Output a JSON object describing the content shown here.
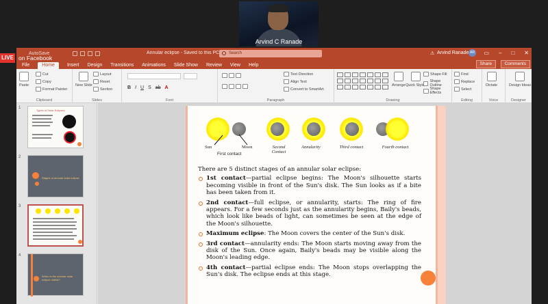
{
  "meeting": {
    "participant_name": "Arvind C Ranade",
    "live_label": "LIVE",
    "stream_label": "on Facebook"
  },
  "app": {
    "autosave": "AutoSave",
    "doc_title": "Annular eclipse - Saved to this PC",
    "search_placeholder": "Search",
    "user_name": "Arvind Ranade",
    "user_initials": "AR",
    "share": "Share",
    "comments": "Comments"
  },
  "menu": [
    "File",
    "Home",
    "Insert",
    "Design",
    "Transitions",
    "Animations",
    "Slide Show",
    "Review",
    "View",
    "Help"
  ],
  "ribbon": {
    "groups": [
      "Clipboard",
      "Slides",
      "Font",
      "Paragraph",
      "Drawing",
      "Editing",
      "Voice",
      "Designer"
    ],
    "clipboard": {
      "paste": "Paste",
      "cut": "Cut",
      "copy": "Copy",
      "format_painter": "Format Painter"
    },
    "slides": {
      "new_slide": "New Slide",
      "layout": "Layout",
      "reset": "Reset",
      "section": "Section"
    },
    "paragraph": {
      "text_direction": "Text Direction",
      "align_text": "Align Text",
      "smartart": "Convert to SmartArt"
    },
    "drawing": {
      "arrange": "Arrange",
      "quick_styles": "Quick Styles",
      "shape_fill": "Shape Fill",
      "shape_outline": "Shape Outline",
      "shape_effects": "Shape Effects"
    },
    "editing": {
      "find": "Find",
      "replace": "Replace",
      "select": "Select"
    },
    "voice": {
      "dictate": "Dictate"
    },
    "designer": {
      "design_ideas": "Design Ideas"
    }
  },
  "thumbnails": [
    {
      "number": "1",
      "title": "Types of Solar Eclipses"
    },
    {
      "number": "2",
      "title": "Stages of annular solar eclipse"
    },
    {
      "number": "3",
      "title": ""
    },
    {
      "number": "4",
      "title": "When is the annular solar eclipse visible?"
    }
  ],
  "slide": {
    "diagram_labels": {
      "sun": "Sun",
      "moon": "Moon",
      "first": "First contact",
      "second": "Second Contact",
      "annularity": "Annularity",
      "third": "Third contact",
      "fourth": "Fourth contact"
    },
    "intro": "There are 5 distinct stages of an annular solar eclipse:",
    "bullets": [
      {
        "term": "1st contact",
        "text": "—partial eclipse begins: The Moon's silhouette starts becoming visible in front of the Sun's disk. The Sun looks as if a bite has been taken from it."
      },
      {
        "term": "2nd contact",
        "text": "—full eclipse, or annularity, starts: The ring of fire appears. For a few seconds just as the annularity begins, Baily's beads, which look like beads of light, can sometimes be seen at the edge of the Moon's silhouette."
      },
      {
        "term": "Maximum eclipse",
        "text": ": The Moon covers the center of the Sun's disk."
      },
      {
        "term": "3rd contact",
        "text": "—annularity ends: The Moon starts moving away from the disk of the Sun. Once again, Baily's beads may be visible along the Moon's leading edge."
      },
      {
        "term": "4th contact",
        "text": "—partial eclipse ends: The Moon stops overlapping the Sun's disk. The eclipse ends at this stage."
      }
    ]
  }
}
